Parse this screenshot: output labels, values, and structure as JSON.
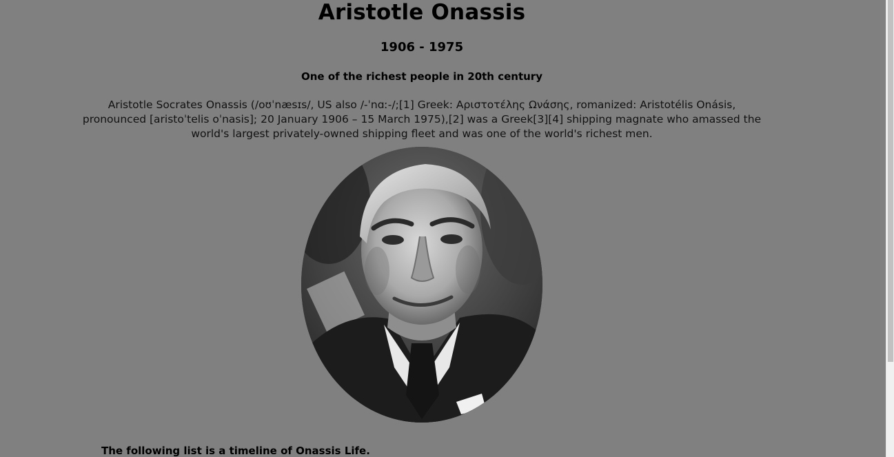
{
  "header": {
    "title": "Aristotle Onassis",
    "years": "1906 - 1975",
    "subtitle": "One of the richest people in 20th century"
  },
  "intro": {
    "text": "Aristotle Socrates Onassis (/oʊˈnæsɪs/, US also /-ˈnɑː-/;[1] Greek: Αριστοτέλης Ωνάσης, romanized: Aristotélis Onásis, pronounced [aristoˈtelis oˈnasis]; 20 January 1906 – 15 March 1975),[2] was a Greek[3][4] shipping magnate who amassed the world's largest privately-owned shipping fleet and was one of the world's richest men."
  },
  "portrait": {
    "alt": "Aristotle Onassis portrait"
  },
  "timeline": {
    "intro": "The following list is a timeline of Onassis Life."
  },
  "colors": {
    "background": "#808080",
    "text": "#000000"
  }
}
